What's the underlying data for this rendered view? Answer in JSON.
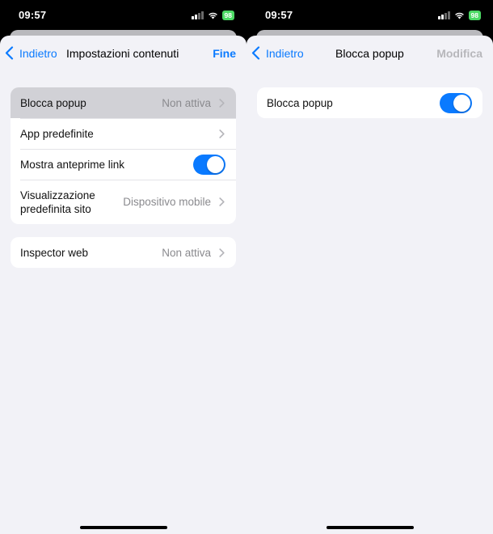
{
  "left_screen": {
    "status": {
      "time": "09:57",
      "battery": "98"
    },
    "nav": {
      "back_label": "Indietro",
      "title": "Impostazioni contenuti",
      "done_label": "Fine"
    },
    "group1": [
      {
        "label": "Blocca popup",
        "value": "Non attiva"
      },
      {
        "label": "App predefinite"
      },
      {
        "label": "Mostra anteprime link",
        "toggle_on": true
      },
      {
        "label_line1": "Visualizzazione",
        "label_line2": "predefinita sito",
        "value": "Dispositivo mobile"
      }
    ],
    "group2": [
      {
        "label": "Inspector web",
        "value": "Non attiva"
      }
    ]
  },
  "right_screen": {
    "status": {
      "time": "09:57",
      "battery": "98"
    },
    "nav": {
      "back_label": "Indietro",
      "title": "Blocca popup",
      "edit_label": "Modifica"
    },
    "group1": [
      {
        "label": "Blocca popup",
        "toggle_on": true
      }
    ]
  },
  "colors": {
    "accent": "#0a7aff",
    "background": "#f2f2f7",
    "battery": "#4cd964"
  }
}
